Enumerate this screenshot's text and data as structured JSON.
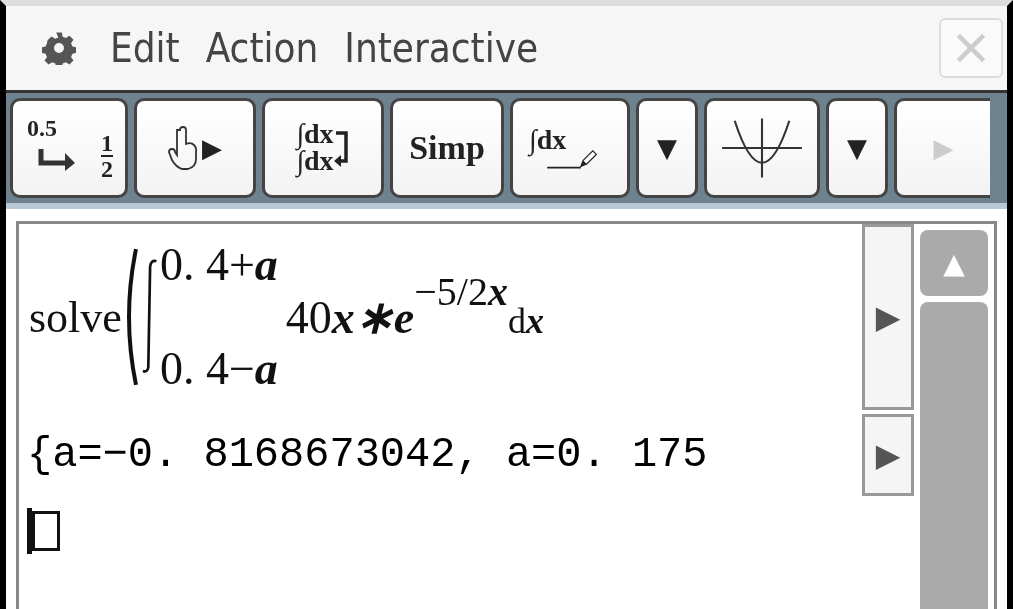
{
  "menu_bar": {
    "items": [
      "Edit",
      "Action",
      "Interactive"
    ],
    "close_disabled": true
  },
  "toolbar": [
    {
      "kind": "convert",
      "texts": [
        "0.5",
        "1",
        "2"
      ]
    },
    {
      "kind": "hand",
      "texts": [
        "▶"
      ]
    },
    {
      "kind": "integral-toggle",
      "texts": [
        "∫dx",
        "∫dx"
      ]
    },
    {
      "kind": "text",
      "texts": [
        "Simp"
      ]
    },
    {
      "kind": "integral-pen",
      "texts": [
        "∫dx"
      ]
    },
    {
      "kind": "dropdown",
      "texts": [
        "▼"
      ]
    },
    {
      "kind": "graph"
    },
    {
      "kind": "dropdown",
      "texts": [
        "▼"
      ]
    },
    {
      "kind": "next",
      "texts": [
        "▶"
      ],
      "disabled": true
    }
  ],
  "work_area": {
    "entry": {
      "function": "solve",
      "upper": "0. 4+**a**",
      "lower": "0. 4−**a**",
      "integrand": "40**x∗e**",
      "exponent": "−5/2**x**",
      "differential": "d**x**",
      "more": "▶"
    },
    "result": {
      "text": "{a=−0. 8168673042, a=0. 175",
      "more": "▶"
    },
    "scrollbar": {
      "up": "▲"
    }
  }
}
